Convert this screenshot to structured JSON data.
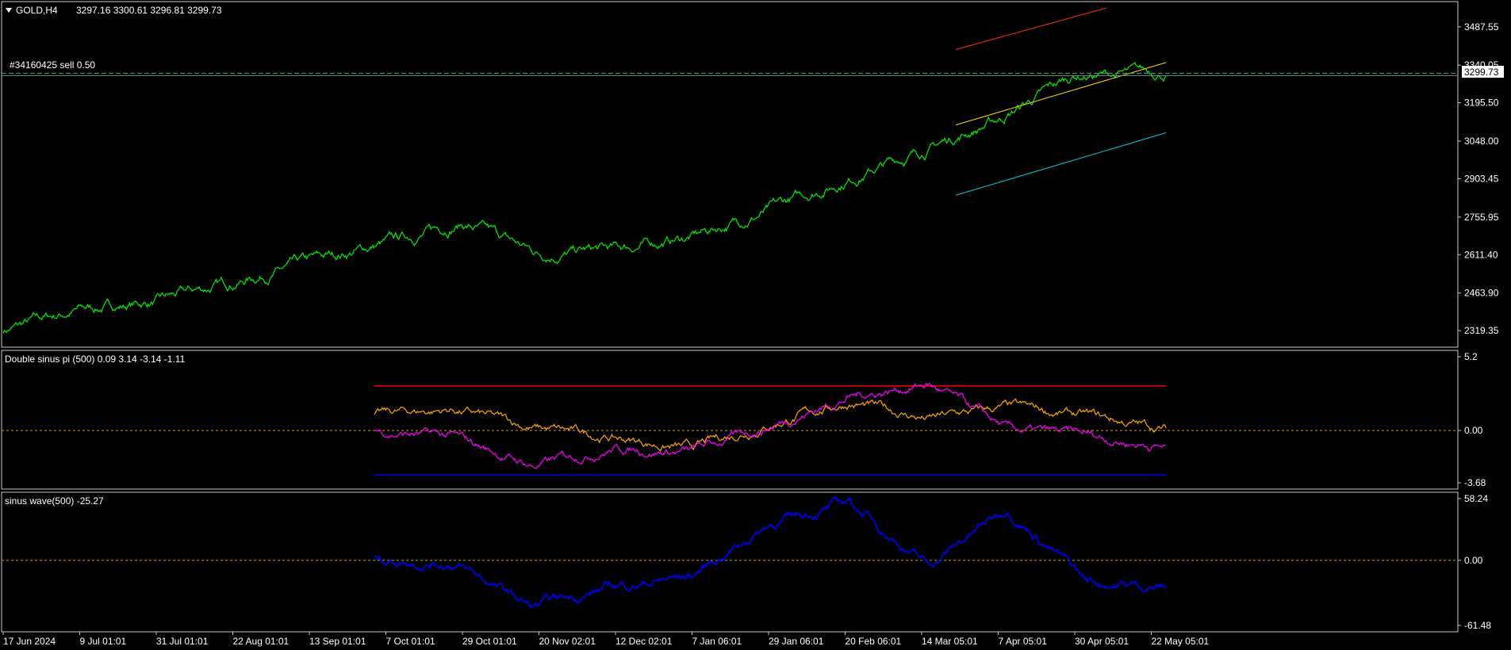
{
  "main": {
    "symbol_label": "GOLD,H4",
    "ohlc_label": "3297.16 3300.61 3296.81 3299.73",
    "order_label": "#34160425 sell 0.50",
    "current_price_label": "3299.73",
    "price_ticks": [
      "3487.55",
      "3340.05",
      "3195.50",
      "3048.00",
      "2903.45",
      "2755.95",
      "2611.40",
      "2463.90",
      "2319.35"
    ]
  },
  "indicator1": {
    "label": "Double sinus pi (500) 0.09 3.14 -3.14 -1.11",
    "ticks": [
      "5.2",
      "0.00",
      "-3.68"
    ]
  },
  "indicator2": {
    "label": "sinus wave(500) -25.27",
    "ticks": [
      "58.24",
      "0.00",
      "-61.48"
    ]
  },
  "time_axis": {
    "labels": [
      "17 Jun 2024",
      "9 Jul 01:01",
      "31 Jul 01:01",
      "22 Aug 01:01",
      "13 Sep 01:01",
      "7 Oct 01:01",
      "29 Oct 01:01",
      "20 Nov 02:01",
      "12 Dec 02:01",
      "7 Jan 06:01",
      "29 Jan 06:01",
      "20 Feb 06:01",
      "14 Mar 05:01",
      "7 Apr 05:01",
      "30 Apr 05:01",
      "22 May 05:01"
    ]
  },
  "colors": {
    "background": "#000000",
    "price_line": "#00ee00",
    "channel_top": "#ff3300",
    "channel_mid": "#ffd700",
    "channel_bottom": "#00ccdd",
    "ind_orange": "#ffa500",
    "ind_magenta": "#ff00ff",
    "ind_red_level": "#ff0000",
    "ind_blue_level": "#0000ff",
    "sinus_wave": "#0000ff",
    "zero_line": "#cca000",
    "order_line": "#3cb371"
  },
  "chart_data": [
    {
      "type": "line",
      "title": "GOLD,H4",
      "ylim": [
        2280,
        3560
      ],
      "x": [
        "17 Jun 2024",
        "9 Jul 01:01",
        "31 Jul 01:01",
        "22 Aug 01:01",
        "13 Sep 01:01",
        "7 Oct 01:01",
        "29 Oct 01:01",
        "20 Nov 02:01",
        "12 Dec 02:01",
        "7 Jan 06:01",
        "29 Jan 06:01",
        "20 Feb 06:01",
        "14 Mar 05:01",
        "7 Apr 05:01",
        "30 Apr 05:01",
        "22 May 05:01"
      ],
      "series": [
        {
          "name": "GOLD,H4",
          "values": [
            2320,
            2400,
            2430,
            2505,
            2580,
            2655,
            2735,
            2615,
            2630,
            2680,
            2780,
            2900,
            3010,
            3130,
            3300,
            3310
          ]
        }
      ],
      "current_price": 3299.73,
      "channel": {
        "top": [
          3400,
          3560
        ],
        "middle": [
          3110,
          3350
        ],
        "bottom": [
          2840,
          3080
        ]
      }
    },
    {
      "type": "line",
      "title": "Double sinus pi (500) 0.09 3.14 -3.14 -1.11",
      "ylim": [
        -3.68,
        5.2
      ],
      "levels": [
        3.14,
        0,
        -3.14
      ],
      "x": [
        "7 Oct 01:01",
        "29 Oct 01:01",
        "20 Nov 02:01",
        "12 Dec 02:01",
        "7 Jan 06:01",
        "29 Jan 06:01",
        "20 Feb 06:01",
        "14 Mar 05:01",
        "7 Apr 05:01",
        "30 Apr 05:01",
        "22 May 05:01"
      ],
      "series": [
        {
          "values": [
            1.1,
            1.5,
            0.2,
            -0.5,
            -1.3,
            0.5,
            2.0,
            0.8,
            1.6,
            1.0,
            0.09
          ]
        },
        {
          "values": [
            0.0,
            -0.5,
            -2.5,
            -1.2,
            -1.5,
            0.3,
            2.4,
            3.3,
            0.0,
            -0.4,
            -1.11
          ]
        }
      ]
    },
    {
      "type": "line",
      "title": "sinus wave(500) -25.27",
      "ylim": [
        -61.48,
        58.24
      ],
      "levels": [
        0
      ],
      "x": [
        "7 Oct 01:01",
        "29 Oct 01:01",
        "20 Nov 02:01",
        "12 Dec 02:01",
        "7 Jan 06:01",
        "29 Jan 06:01",
        "20 Feb 06:01",
        "14 Mar 05:01",
        "7 Apr 05:01",
        "30 Apr 05:01",
        "22 May 05:01"
      ],
      "series": [
        {
          "values": [
            2,
            -2,
            -45,
            -25,
            -15,
            35,
            55,
            -5,
            50,
            -20,
            -25.27
          ]
        }
      ]
    }
  ]
}
